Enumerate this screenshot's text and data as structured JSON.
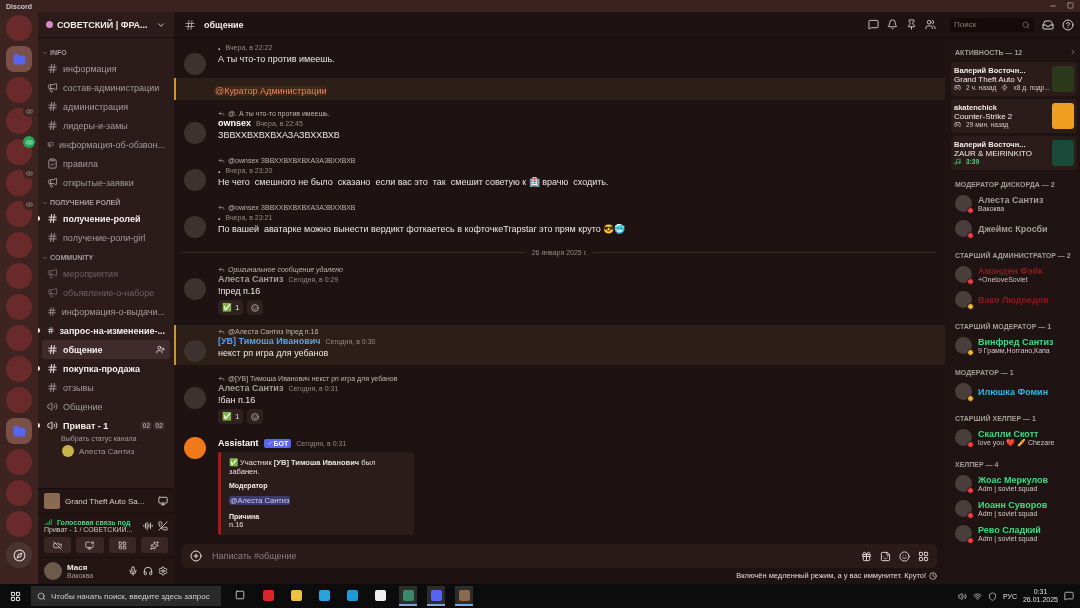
{
  "window": {
    "title": "Discord"
  },
  "servers": [
    {
      "kind": "avatar",
      "in_voice": false
    },
    {
      "kind": "folder",
      "in_voice": false
    },
    {
      "kind": "avatar",
      "in_voice": false
    },
    {
      "kind": "avatar",
      "in_voice": true,
      "speaking": false
    },
    {
      "kind": "avatar",
      "in_voice": true,
      "speaking": true
    },
    {
      "kind": "avatar",
      "in_voice": true,
      "speaking": false
    },
    {
      "kind": "avatar",
      "in_voice": true,
      "speaking": false
    },
    {
      "kind": "avatar",
      "in_voice": false
    },
    {
      "kind": "avatar",
      "in_voice": false
    },
    {
      "kind": "avatar",
      "in_voice": false
    },
    {
      "kind": "avatar",
      "in_voice": false
    },
    {
      "kind": "avatar",
      "in_voice": false
    },
    {
      "kind": "avatar",
      "in_voice": false
    },
    {
      "kind": "folder",
      "in_voice": false
    },
    {
      "kind": "avatar",
      "in_voice": false
    },
    {
      "kind": "avatar",
      "in_voice": false
    },
    {
      "kind": "avatar",
      "in_voice": false
    },
    {
      "kind": "discover",
      "in_voice": false
    }
  ],
  "server": {
    "name": "СОВЕТСКИЙ | ФРА..."
  },
  "categories": [
    {
      "name": "INFO",
      "channels": [
        {
          "name": "информация",
          "kind": "text",
          "selected": false,
          "unread": false,
          "muted": false
        },
        {
          "name": "состав-администрации",
          "kind": "announce",
          "selected": false,
          "unread": false,
          "muted": false
        },
        {
          "name": "администрация",
          "kind": "text",
          "selected": false,
          "unread": false,
          "muted": false
        },
        {
          "name": "лидеры-и-замы",
          "kind": "text",
          "selected": false,
          "unread": false,
          "muted": false
        },
        {
          "name": "информация-об-обзвон...",
          "kind": "announce",
          "selected": false,
          "unread": false,
          "muted": false
        },
        {
          "name": "правила",
          "kind": "rules",
          "selected": false,
          "unread": false,
          "muted": false
        },
        {
          "name": "открытые-заявки",
          "kind": "announce",
          "selected": false,
          "unread": false,
          "muted": false
        }
      ]
    },
    {
      "name": "ПОЛУЧЕНИЕ РОЛЕЙ",
      "channels": [
        {
          "name": "получение-ролей",
          "kind": "text",
          "selected": false,
          "unread": true,
          "muted": false
        },
        {
          "name": "получение-роли-girl",
          "kind": "text",
          "selected": false,
          "unread": false,
          "muted": false
        }
      ]
    },
    {
      "name": "COMMUNITY",
      "channels": [
        {
          "name": "мероприятия",
          "kind": "announce",
          "selected": false,
          "unread": false,
          "muted": true
        },
        {
          "name": "объявление-о-наборе",
          "kind": "announce",
          "selected": false,
          "unread": false,
          "muted": true
        },
        {
          "name": "информация-о-выдачи...",
          "kind": "text",
          "selected": false,
          "unread": false,
          "muted": false
        },
        {
          "name": "запрос-на-изменение-...",
          "kind": "text",
          "selected": false,
          "unread": true,
          "muted": false
        },
        {
          "name": "общение",
          "kind": "text",
          "selected": true,
          "unread": false,
          "muted": false
        },
        {
          "name": "покупка-продажа",
          "kind": "text",
          "selected": false,
          "unread": true,
          "muted": false
        },
        {
          "name": "отзывы",
          "kind": "text",
          "selected": false,
          "unread": false,
          "muted": false
        },
        {
          "name": "Общение",
          "kind": "voice",
          "selected": false,
          "unread": false,
          "muted": false
        },
        {
          "name": "Приват - 1",
          "kind": "voice",
          "selected": false,
          "unread": true,
          "muted": false,
          "counts": [
            "02",
            "02"
          ],
          "status": "Выбрать статус канала",
          "members": [
            {
              "name": "Алеста Сантиз"
            }
          ]
        }
      ]
    }
  ],
  "activity_panel": {
    "game": "Grand Theft Auto Sa..."
  },
  "voice_panel": {
    "status": "Голосовая связь под",
    "channel": "Приват - 1 / СОВЕТСКИЙ..."
  },
  "user": {
    "name": "Мася",
    "status": "Вакоква"
  },
  "channel": {
    "name": "общение"
  },
  "search": {
    "placeholder": "Поиск"
  },
  "messages": [
    {
      "kind": "message",
      "highlighted": false,
      "author": ".",
      "time": "Вчера, в 22:22",
      "text": "А ты что-то против имеешь."
    },
    {
      "kind": "mention",
      "highlighted": true,
      "text": "@Куратор Администрации"
    },
    {
      "kind": "message",
      "highlighted": false,
      "reply": "@. А ты что-то против имеешь.",
      "author": "ownsex",
      "color": "#ffffff",
      "time": "Вчера, в 22:45",
      "text": "ЗВВХХВХВХВХАЗАЗВХХВХВ"
    },
    {
      "kind": "message",
      "highlighted": false,
      "reply": "@ownsex ЗВВХХВХВХВХАЗАЗВХХВХВ",
      "author": ".",
      "time": "Вчера, в 23:20",
      "text": "Не чего  смешного не было  сказано  если вас это  так  смешит советую к 🏥 врачю  сходить."
    },
    {
      "kind": "message",
      "highlighted": false,
      "reply": "@ownsex ЗВВХХВХВХВХАЗАЗВХХВХВ",
      "author": ".",
      "time": "Вчера, в 23:21",
      "text": "По вашей  аватарке можно вынести вердикт фоткаетесь в кофточкеTrapstar это прям круто 😎🥶"
    },
    {
      "kind": "divider",
      "text": "26 января 2025 г."
    },
    {
      "kind": "message",
      "highlighted": false,
      "reply": "Оригинальное сообщение удалено",
      "reply_deleted": true,
      "author": "Алеста Сантиз",
      "color": "#a39c99",
      "time": "Сегодня, в 0:29",
      "text": "!пред п.16",
      "reactions": [
        {
          "emoji": "✅",
          "count": "1"
        }
      ]
    },
    {
      "kind": "message",
      "highlighted": true,
      "reply": "@Алеста Сантиз !пред п.16",
      "author": "[УВ] Тимоша Иванович",
      "color": "#5aa0e6",
      "time": "Сегодня, в 0:30",
      "text": "некст рп игра для уебанов"
    },
    {
      "kind": "message",
      "highlighted": false,
      "reply": "@[УВ] Тимоша Иванович некст рп игра для уебанов",
      "author": "Алеста Сантиз",
      "color": "#a39c99",
      "time": "Сегодня, в 0:31",
      "text": "!бан п.16",
      "reactions": [
        {
          "emoji": "✅",
          "count": "1"
        }
      ]
    },
    {
      "kind": "bot",
      "highlighted": false,
      "author": "Assistant",
      "color": "#ffffff",
      "tag": "БОТ",
      "time": "Сегодня, в 0:31",
      "embed": {
        "description": "✅ Участник **[УВ] Тимоша Иванович** был забанен.",
        "fields": [
          {
            "name": "Модератор",
            "value": "@Алеста Сантиз",
            "kind": "mention"
          },
          {
            "name": "Причина",
            "value": "п.16",
            "kind": "text"
          }
        ]
      }
    }
  ],
  "composer": {
    "placeholder": "Написать #общение"
  },
  "slowmode": "Включён медленный режим, а у вас иммунитет. Круто!",
  "activity": {
    "title": "АКТИВНОСТЬ — 12",
    "cards": [
      {
        "kind": "game",
        "user": "Валерий Восточн...",
        "title": "Grand Theft Auto V",
        "details": [
          "2 ч. назад",
          "x8 д. подр..."
        ]
      },
      {
        "kind": "game",
        "user": "akatenchick",
        "title": "Counter-Strike 2",
        "details": [
          "29 мин. назад"
        ]
      },
      {
        "kind": "music",
        "user": "Валерий Восточн...",
        "title": "ZAUR & MEIRINKITO",
        "details": [
          "3:39"
        ]
      }
    ]
  },
  "member_groups": [
    {
      "title": "МОДЕРАТОР ДИСКОРДА — 2",
      "members": [
        {
          "name": "Алеста Сантиз",
          "color": "#a39c99",
          "status": "Вакоква",
          "dnd": true
        },
        {
          "name": "Джеймс Кросби",
          "color": "#a39c99",
          "dnd": true
        }
      ]
    },
    {
      "title": "СТАРШИЙ АДМИНИСТРАТОР — 2",
      "members": [
        {
          "name": "Аманден Фэйк",
          "color": "#8c1c1c",
          "status": "+OneloveSoviet",
          "dnd": true
        },
        {
          "name": "Вако Людоедов",
          "color": "#8c1c1c",
          "dnd": false
        }
      ]
    },
    {
      "title": "СТАРШИЙ МОДЕРАТОР — 1",
      "members": [
        {
          "name": "Винфред Сантиз",
          "color": "#3ddc84",
          "status": "9 Грамм,Ноггано,Капа",
          "dnd": false
        }
      ]
    },
    {
      "title": "МОДЕРАТОР — 1",
      "members": [
        {
          "name": "Илюшка Фомин",
          "color": "#2bb8e8",
          "dnd": false
        }
      ]
    },
    {
      "title": "СТАРШИЙ ХЕЛПЕР — 1",
      "members": [
        {
          "name": "Скалли Скотт",
          "color": "#3ddc84",
          "status": "love you ❤️ 🥖 Chezare",
          "dnd": true
        }
      ]
    },
    {
      "title": "ХЕЛПЕР — 4",
      "members": [
        {
          "name": "Жоас Меркулов",
          "color": "#3ddc84",
          "status": "Adm | soviet squad",
          "dnd": true
        },
        {
          "name": "Иоанн Суворов",
          "color": "#3ddc84",
          "status": "Adm | soviet squad",
          "dnd": true
        },
        {
          "name": "Рево Сладкий",
          "color": "#3ddc84",
          "status": "Adm | soviet squad",
          "dnd": true
        }
      ]
    }
  ],
  "taskbar": {
    "search_placeholder": "Чтобы начать поиск, введите здесь запрос",
    "apps": [
      {
        "kind": "taskview",
        "active": false
      },
      {
        "kind": "red",
        "active": false
      },
      {
        "kind": "folder",
        "active": false
      },
      {
        "kind": "telegram",
        "active": false
      },
      {
        "kind": "edge",
        "active": false
      },
      {
        "kind": "yandex",
        "active": false
      },
      {
        "kind": "window",
        "active": true
      },
      {
        "kind": "discord",
        "active": true
      },
      {
        "kind": "game",
        "active": true
      }
    ],
    "language": "РУС",
    "time": "0:31",
    "date": "26.01.2025"
  }
}
